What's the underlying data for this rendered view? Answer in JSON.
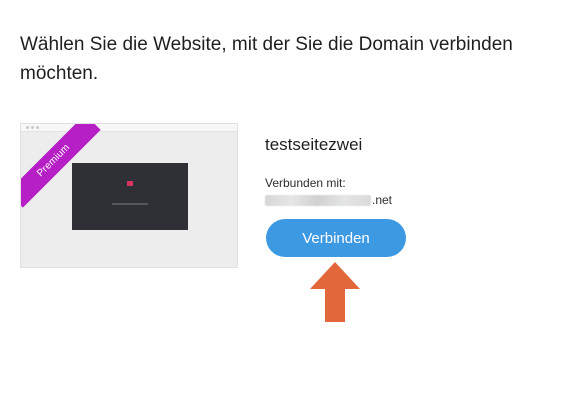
{
  "heading": "Wählen Sie die Website, mit der Sie die Domain verbinden möchten.",
  "site": {
    "badge": "Premium",
    "name": "testseitezwei",
    "connected_label": "Verbunden mit:",
    "connected_domain_visible_suffix": ".net",
    "connect_button_label": "Verbinden"
  },
  "colors": {
    "button": "#3e99e3",
    "badge": "#b71fc6",
    "arrow": "#e2673a"
  },
  "icons": {
    "annotation": "up-arrow-icon"
  }
}
